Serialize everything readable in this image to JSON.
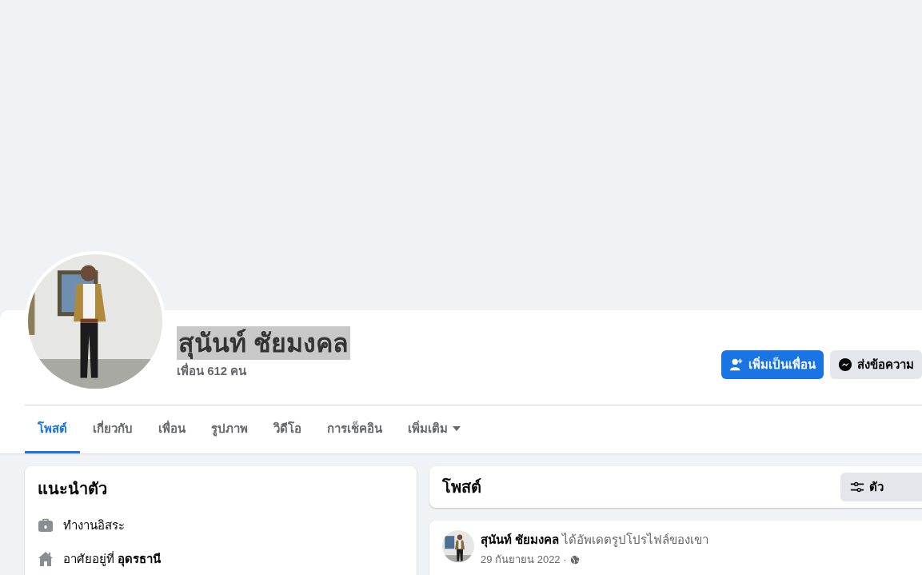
{
  "profile": {
    "name": "สุนันท์ ชัยมงคล",
    "name_highlighted": true,
    "friends": "เพื่อน 612 คน"
  },
  "actions": [
    {
      "kind": "primary",
      "label": "เพิ่มเป็นเพื่อน"
    },
    {
      "kind": "secondary",
      "label": "ส่งข้อความ"
    }
  ],
  "tabs": [
    {
      "label": "โพสต์",
      "selected": true,
      "dropdown": false
    },
    {
      "label": "เกี่ยวกับ",
      "selected": false,
      "dropdown": false
    },
    {
      "label": "เพื่อน",
      "selected": false,
      "dropdown": false
    },
    {
      "label": "รูปภาพ",
      "selected": false,
      "dropdown": false
    },
    {
      "label": "วิดีโอ",
      "selected": false,
      "dropdown": false
    },
    {
      "label": "การเช็คอิน",
      "selected": false,
      "dropdown": false
    },
    {
      "label": "เพิ่มเติม",
      "selected": false,
      "dropdown": true
    }
  ],
  "intro": {
    "title": "แนะนำตัว",
    "items": [
      {
        "kind": "work",
        "text": "ทำงานอิสระ"
      },
      {
        "kind": "home",
        "text": "อาศัยอยู่ที่ **อุดรธานี**"
      }
    ]
  },
  "posts_header": {
    "title": "โพสต์",
    "filter_button": "ตัว"
  },
  "post": {
    "author": "สุนันท์ ชัยมงคล",
    "action": "ได้อัพเดตรูปโปรไฟล์ของเขา",
    "date": "29 กันยายน 2022 ·",
    "public": true
  }
}
